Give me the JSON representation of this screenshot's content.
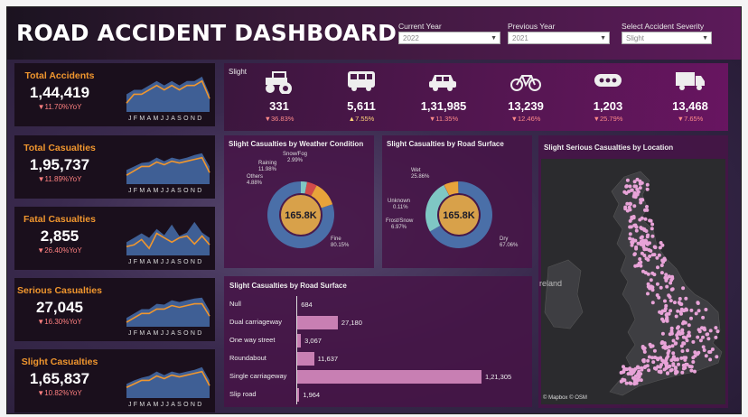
{
  "header": {
    "title": "ROAD ACCIDENT DASHBOARD",
    "filters": [
      {
        "label": "Current Year",
        "value": "2022"
      },
      {
        "label": "Previous Year",
        "value": "2021"
      },
      {
        "label": "Select Accident Severity",
        "value": "Slight"
      }
    ]
  },
  "kpis": [
    {
      "label": "Total Accidents",
      "value": "1,44,419",
      "yoy": "▼11.70%YoY",
      "curr": [
        6,
        7,
        7,
        7.5,
        8,
        7.5,
        8,
        7.5,
        8,
        8,
        8.5,
        6.5
      ],
      "prev": [
        7,
        7.5,
        7.5,
        8,
        8.5,
        8,
        8.5,
        8,
        8.5,
        8.5,
        9,
        7
      ]
    },
    {
      "label": "Total Casualties",
      "value": "1,95,737",
      "yoy": "▼11.89%YoY",
      "curr": [
        6,
        6.5,
        7,
        7,
        7.5,
        7.2,
        7.6,
        7.4,
        7.6,
        7.8,
        8,
        6.3
      ],
      "prev": [
        6.6,
        7,
        7.4,
        7.5,
        8,
        7.6,
        8,
        7.8,
        8,
        8.3,
        8.5,
        7
      ]
    },
    {
      "label": "Fatal Casualties",
      "value": "2,855",
      "yoy": "▼26.40%YoY",
      "curr": [
        6,
        6.2,
        6.8,
        5.8,
        7.5,
        7,
        6.5,
        7,
        7.2,
        6.3,
        7.2,
        6.2
      ],
      "prev": [
        6.5,
        7,
        7.5,
        7,
        8,
        7.3,
        8.5,
        7.2,
        7.6,
        8.8,
        7.6,
        7
      ]
    },
    {
      "label": "Serious Casualties",
      "value": "27,045",
      "yoy": "▼16.30%YoY",
      "curr": [
        5.5,
        6,
        6.5,
        6.5,
        7,
        7,
        7.4,
        7.2,
        7.4,
        7.6,
        7.6,
        6.2
      ],
      "prev": [
        6,
        6.5,
        7,
        7,
        7.6,
        7.5,
        8,
        7.8,
        8,
        8.2,
        8.3,
        6.8
      ]
    },
    {
      "label": "Slight Casualties",
      "value": "1,65,837",
      "yoy": "▼10.82%YoY",
      "curr": [
        6.2,
        6.6,
        7,
        7,
        7.5,
        7.2,
        7.6,
        7.4,
        7.6,
        7.8,
        8,
        6.4
      ],
      "prev": [
        6.6,
        7,
        7.3,
        7.5,
        8,
        7.6,
        8,
        7.8,
        8,
        8.2,
        8.5,
        7
      ]
    }
  ],
  "months": "JFMAMJJASOND",
  "vehicles": {
    "title": "Slight",
    "items": [
      {
        "icon": "tractor-icon",
        "value": "331",
        "yoy": "▼36.83%",
        "dir": "down"
      },
      {
        "icon": "bus-icon",
        "value": "5,611",
        "yoy": "▲7.55%",
        "dir": "up"
      },
      {
        "icon": "car-icon",
        "value": "1,31,985",
        "yoy": "▼11.35%",
        "dir": "down"
      },
      {
        "icon": "bicycle-icon",
        "value": "13,239",
        "yoy": "▼12.46%",
        "dir": "down"
      },
      {
        "icon": "other-icon",
        "value": "1,203",
        "yoy": "▼25.79%",
        "dir": "down"
      },
      {
        "icon": "van-icon",
        "value": "13,468",
        "yoy": "▼7.65%",
        "dir": "down"
      }
    ]
  },
  "weather": {
    "title": "Slight Casualties by Weather Condition",
    "center": "165.8K",
    "slices": [
      {
        "name": "Fine",
        "pct": 80.15,
        "color": "#4a6fa8"
      },
      {
        "name": "Raining",
        "pct": 11.98,
        "color": "#e8a33a"
      },
      {
        "name": "Others",
        "pct": 4.88,
        "color": "#d24b4b"
      },
      {
        "name": "Snow/Fog",
        "pct": 2.99,
        "color": "#7fc7c4"
      }
    ],
    "labels": {
      "fine": "Fine",
      "fine_pct": "80.15%",
      "raining": "Raining",
      "raining_pct": "11.98%",
      "others": "Others",
      "others_pct": "4.88%",
      "snow": "Snow/Fog",
      "snow_pct": "2.99%"
    }
  },
  "surface": {
    "title": "Slight Casualties by Road Surface",
    "center": "165.8K",
    "slices": [
      {
        "name": "Dry",
        "pct": 67.06,
        "color": "#4a6fa8"
      },
      {
        "name": "Frost/Snow",
        "pct": 6.97,
        "color": "#e8a33a"
      },
      {
        "name": "Unknown",
        "pct": 0.11,
        "color": "#d24b4b"
      },
      {
        "name": "Wet",
        "pct": 25.86,
        "color": "#7fc7c4"
      }
    ],
    "labels": {
      "dry": "Dry",
      "dry_pct": "67.06%",
      "wet": "Wet",
      "wet_pct": "25.86%",
      "unknown": "Unknown",
      "unknown_pct": "0.11%",
      "frost": "Frost/Snow",
      "frost_pct": "6.97%"
    }
  },
  "road_type": {
    "title": "Slight Casualties by Road Surface",
    "rows": [
      {
        "name": "Null",
        "value": 684,
        "label": "684"
      },
      {
        "name": "Dual carriageway",
        "value": 27180,
        "label": "27,180"
      },
      {
        "name": "One way street",
        "value": 3067,
        "label": "3,067"
      },
      {
        "name": "Roundabout",
        "value": 11637,
        "label": "11,637"
      },
      {
        "name": "Single carriageway",
        "value": 121305,
        "label": "1,21,305"
      },
      {
        "name": "Slip road",
        "value": 1964,
        "label": "1,964"
      }
    ]
  },
  "map": {
    "title": "Slight Serious Casualties by Location",
    "ireland": "reland",
    "attribution": "© Mapbox © OSM"
  },
  "chart_data": {
    "type": "bar",
    "title": "Slight Casualties by Road Surface",
    "categories": [
      "Null",
      "Dual carriageway",
      "One way street",
      "Roundabout",
      "Single carriageway",
      "Slip road"
    ],
    "values": [
      684,
      27180,
      3067,
      11637,
      121305,
      1964
    ]
  }
}
